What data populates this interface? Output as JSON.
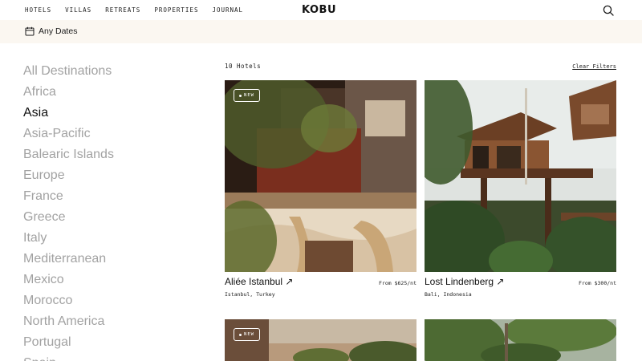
{
  "nav": {
    "links": [
      "HOTELS",
      "VILLAS",
      "RETREATS",
      "PROPERTIES",
      "JOURNAL"
    ],
    "logo": "KOBU",
    "search_icon": "search-icon"
  },
  "filter_bar": {
    "dates_label": "Any Dates",
    "icon": "calendar-icon"
  },
  "sidebar": {
    "destinations": [
      {
        "label": "All Destinations",
        "active": false
      },
      {
        "label": "Africa",
        "active": false
      },
      {
        "label": "Asia",
        "active": true
      },
      {
        "label": "Asia-Pacific",
        "active": false
      },
      {
        "label": "Balearic Islands",
        "active": false
      },
      {
        "label": "Europe",
        "active": false
      },
      {
        "label": "France",
        "active": false
      },
      {
        "label": "Greece",
        "active": false
      },
      {
        "label": "Italy",
        "active": false
      },
      {
        "label": "Mediterranean",
        "active": false
      },
      {
        "label": "Mexico",
        "active": false
      },
      {
        "label": "Morocco",
        "active": false
      },
      {
        "label": "North America",
        "active": false
      },
      {
        "label": "Portugal",
        "active": false
      },
      {
        "label": "Spain",
        "active": false
      }
    ]
  },
  "main": {
    "count_label": "10 Hotels",
    "clear_filters": "Clear Filters",
    "hotels": [
      {
        "name": "Aliée Istanbul ↗",
        "price": "From $625/nt",
        "location": "Istanbul, Turkey",
        "badge": "NEW"
      },
      {
        "name": "Lost Lindenberg ↗",
        "price": "From $300/nt",
        "location": "Bali, Indonesia",
        "badge": ""
      },
      {
        "name": "",
        "price": "",
        "location": "",
        "badge": "NEW"
      },
      {
        "name": "",
        "price": "",
        "location": "",
        "badge": ""
      }
    ]
  },
  "colors": {
    "accent_bg": "#fbf7f1",
    "inactive_text": "#a2a2a2",
    "active_text": "#111111"
  }
}
